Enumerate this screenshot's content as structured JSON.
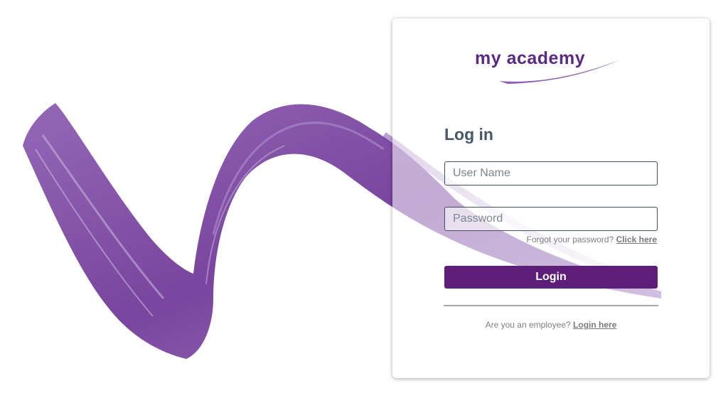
{
  "brand": {
    "logo_text": "my academy",
    "accent_color": "#5c1e78",
    "logo_color": "#5b2a82"
  },
  "form": {
    "title": "Log in",
    "username_placeholder": "User Name",
    "username_value": "",
    "password_placeholder": "Password",
    "password_value": "",
    "forgot_prefix": "Forgot your password?",
    "forgot_link": "Click here",
    "login_label": "Login",
    "employee_prefix": "Are you an employee?",
    "employee_link": "Login here"
  },
  "decoration": {
    "icon": "purple-brush-stroke-icon"
  }
}
